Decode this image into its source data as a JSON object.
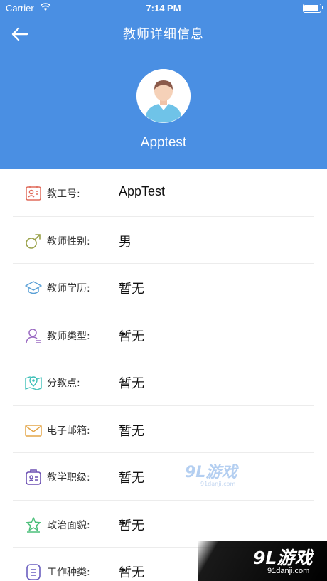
{
  "status_bar": {
    "carrier": "Carrier",
    "time": "7:14 PM"
  },
  "nav": {
    "title": "教师详细信息",
    "back_icon": "arrow-left-icon"
  },
  "profile": {
    "name": "Apptest",
    "avatar_icon": "user-avatar-icon"
  },
  "rows": [
    {
      "label": "教工号:",
      "value": "AppTest",
      "icon": "id-card-icon",
      "color": "#e06b5b"
    },
    {
      "label": "教师性别:",
      "value": "男",
      "icon": "male-icon",
      "color": "#9aa24a"
    },
    {
      "label": "教师学历:",
      "value": "暂无",
      "icon": "graduation-cap-icon",
      "color": "#5aa0d6"
    },
    {
      "label": "教师类型:",
      "value": "暂无",
      "icon": "user-type-icon",
      "color": "#9b6bc2"
    },
    {
      "label": "分教点:",
      "value": "暂无",
      "icon": "map-pin-icon",
      "color": "#3ec0b8"
    },
    {
      "label": "电子邮箱:",
      "value": "暂无",
      "icon": "mail-icon",
      "color": "#e4a548"
    },
    {
      "label": "教学职级:",
      "value": "暂无",
      "icon": "badge-icon",
      "color": "#6b4fb2"
    },
    {
      "label": "政治面貌:",
      "value": "暂无",
      "icon": "star-icon",
      "color": "#4cbf7a"
    },
    {
      "label": "工作种类:",
      "value": "暂无",
      "icon": "list-icon",
      "color": "#6a5fc0"
    }
  ],
  "watermark": {
    "brand": "9L游戏",
    "site": "91danji.com"
  },
  "colors": {
    "header": "#4a8fe3"
  }
}
